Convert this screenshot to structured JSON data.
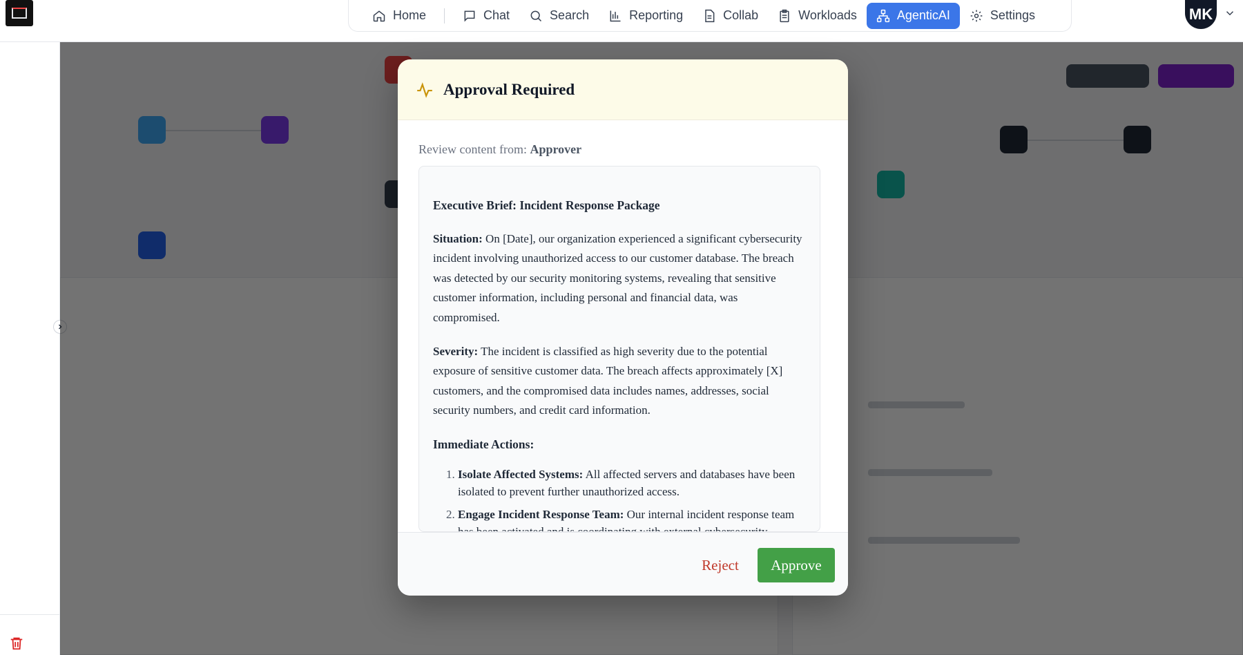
{
  "nav": {
    "items": [
      {
        "label": "Home",
        "icon": "home-icon"
      },
      {
        "label": "Chat",
        "icon": "chat-icon"
      },
      {
        "label": "Search",
        "icon": "search-icon"
      },
      {
        "label": "Reporting",
        "icon": "bar-chart-icon"
      },
      {
        "label": "Collab",
        "icon": "document-icon"
      },
      {
        "label": "Workloads",
        "icon": "clipboard-icon"
      },
      {
        "label": "AgenticAI",
        "icon": "workflow-icon",
        "active": true
      },
      {
        "label": "Settings",
        "icon": "gear-icon"
      }
    ],
    "accent": "#3b76e8"
  },
  "user": {
    "initials": "MK"
  },
  "modal": {
    "title": "Approval Required",
    "review_prefix": "Review content from:",
    "review_source": "Approver",
    "content": {
      "heading": "Executive Brief: Incident Response Package",
      "situation_label": "Situation:",
      "situation_text": " On [Date], our organization experienced a significant cybersecurity incident involving unauthorized access to our customer database. The breach was detected by our security monitoring systems, revealing that sensitive customer information, including personal and financial data, was compromised.",
      "severity_label": "Severity:",
      "severity_text": " The incident is classified as high severity due to the potential exposure of sensitive customer data. The breach affects approximately [X] customers, and the compromised data includes names, addresses, social security numbers, and credit card information.",
      "actions_heading": "Immediate Actions:",
      "actions": [
        {
          "label": "Isolate Affected Systems:",
          "text": " All affected servers and databases have been isolated to prevent further unauthorized access."
        },
        {
          "label": "Engage Incident Response Team:",
          "text": " Our internal incident response team has been activated and is coordinating with external cybersecurity experts."
        }
      ]
    },
    "reject_label": "Reject",
    "approve_label": "Approve",
    "colors": {
      "header_bg": "#fdfbe8",
      "approve": "#43a047",
      "reject": "#c0392b",
      "title_icon": "#c9940a"
    }
  }
}
